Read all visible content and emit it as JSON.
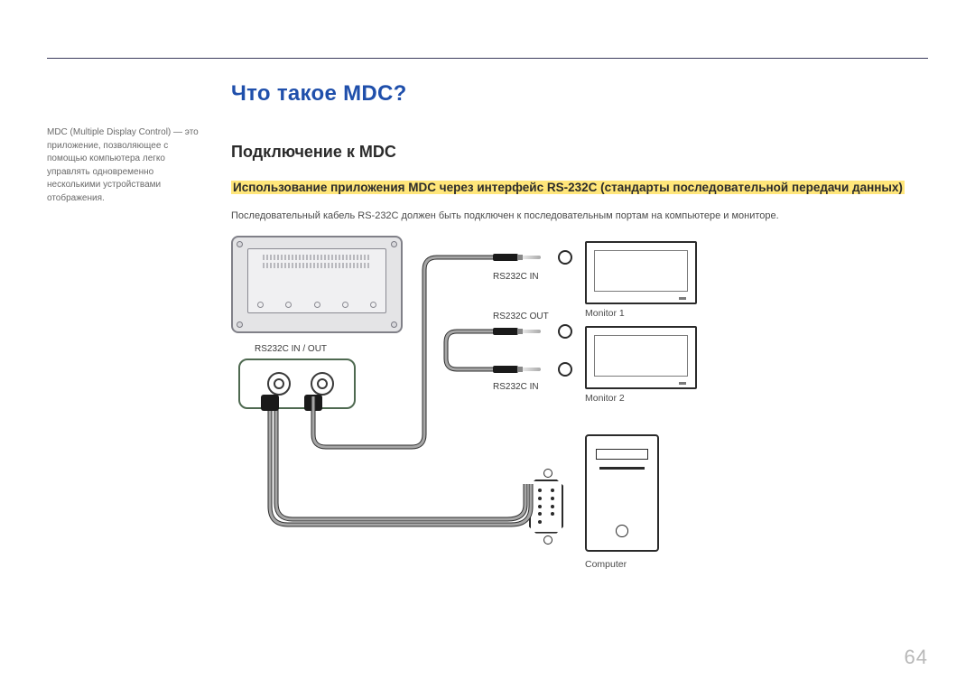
{
  "page_number": "64",
  "sidebar": {
    "description": "MDC (Multiple Display Control) — это приложение, позволяющее с помощью компьютера легко управлять одновременно несколькими устройствами отображения."
  },
  "main": {
    "title": "Что такое MDC?",
    "section_title": "Подключение к MDC",
    "highlight": "Использование приложения MDC через интерфейс RS-232C (стандарты последовательной передачи данных)",
    "note": "Последовательный кабель RS-232C должен быть подключен к последовательным портам на компьютере и мониторе."
  },
  "diagram": {
    "port_plate_label": "RS232C IN / OUT",
    "jack1_label": "RS232C IN",
    "jack2_label": "RS232C OUT",
    "jack3_label": "RS232C IN",
    "monitor1_label": "Monitor 1",
    "monitor2_label": "Monitor 2",
    "computer_label": "Computer"
  }
}
